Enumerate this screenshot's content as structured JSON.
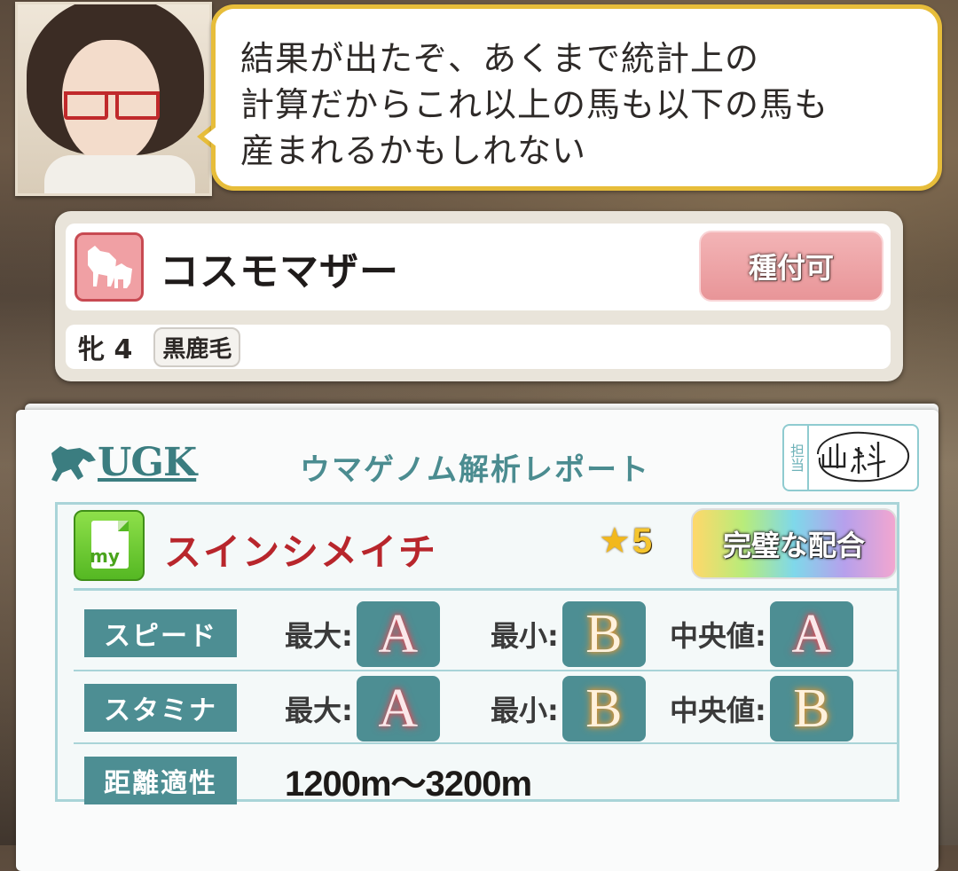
{
  "dialog": {
    "speaker_icon": "glasses-woman-portrait",
    "lines": [
      "結果が出たぞ、あくまで統計上の",
      "計算だからこれ以上の馬も以下の馬も",
      "産まれるかもしれない"
    ]
  },
  "horse": {
    "icon": "mare-foal-icon",
    "name": "コスモマザー",
    "breed_button": "種付可",
    "sex_age": "牝 4",
    "coat": "黒鹿毛"
  },
  "report": {
    "logo": "UGK",
    "title": "ウマゲノム解析レポート",
    "stamp_label": "担当",
    "stamp_signature": "山料",
    "sire": {
      "icon": "my-icon",
      "icon_text": "my",
      "name": "スインシメイチ",
      "stars": "5",
      "match_badge": "完璧な配合"
    },
    "stats": [
      {
        "label": "スピード",
        "max_label": "最大:",
        "max": "A",
        "min_label": "最小:",
        "min": "B",
        "median_label": "中央値:",
        "median": "A"
      },
      {
        "label": "スタミナ",
        "max_label": "最大:",
        "max": "A",
        "min_label": "最小:",
        "min": "B",
        "median_label": "中央値:",
        "median": "B"
      }
    ],
    "distance": {
      "label": "距離適性",
      "value": "1200m〜3200m"
    }
  },
  "colors": {
    "bubble_border": "#e7bd3a",
    "teal": "#4d8e93",
    "sire_name": "#b8262c",
    "breed_button": "#e89598"
  }
}
